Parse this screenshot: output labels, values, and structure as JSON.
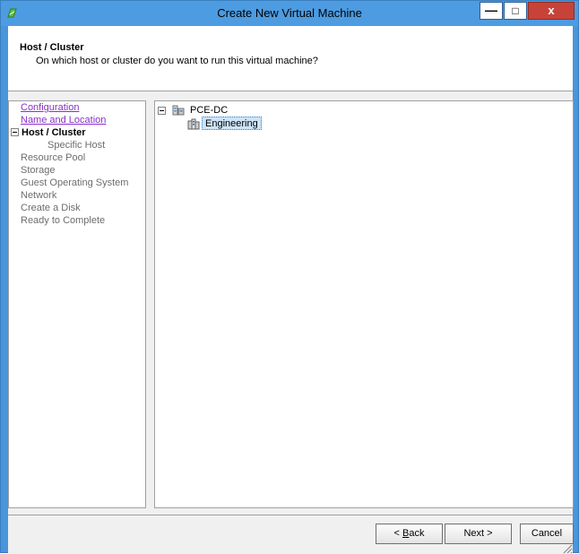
{
  "window": {
    "title": "Create New Virtual Machine",
    "controls": {
      "minimize": "—",
      "maximize": "□",
      "close": "x"
    }
  },
  "header": {
    "title": "Host / Cluster",
    "subtitle": "On which host or cluster do you want to run this virtual machine?"
  },
  "steps": [
    {
      "label": "Configuration",
      "state": "visited"
    },
    {
      "label": "Name and Location",
      "state": "visited"
    },
    {
      "label": "Host / Cluster",
      "state": "current"
    },
    {
      "label": "Specific Host",
      "state": "pending-sub"
    },
    {
      "label": "Resource Pool",
      "state": "pending"
    },
    {
      "label": "Storage",
      "state": "pending"
    },
    {
      "label": "Guest Operating System",
      "state": "pending"
    },
    {
      "label": "Network",
      "state": "pending"
    },
    {
      "label": "Create a Disk",
      "state": "pending"
    },
    {
      "label": "Ready to Complete",
      "state": "pending"
    }
  ],
  "tree": {
    "datacenter": {
      "label": "PCE-DC",
      "icon": "datacenter-icon",
      "expanded": true
    },
    "cluster": {
      "label": "Engineering",
      "icon": "cluster-icon",
      "selected": true
    }
  },
  "buttons": {
    "back": {
      "prefix": "",
      "accel": "B",
      "rest": "ack",
      "lead": "< "
    },
    "next": {
      "label": "Next >"
    },
    "cancel": {
      "label": "Cancel"
    }
  },
  "colors": {
    "titlebar": "#4d9be0",
    "link_visited": "#8b2fc9",
    "selection": "#cce4f7",
    "close_button": "#c7433a"
  }
}
